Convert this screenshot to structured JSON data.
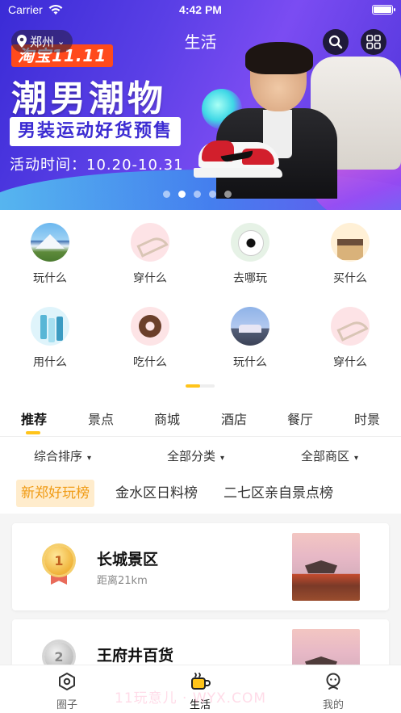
{
  "status_bar": {
    "carrier": "Carrier",
    "time": "4:42 PM"
  },
  "header": {
    "location": "郑州",
    "title": "生活"
  },
  "banner": {
    "badge": "淘宝11.11",
    "headline": "潮男潮物",
    "subheadline": "男装运动好货预售",
    "date_line": "活动时间：10.20-10.31",
    "slide_count": 5,
    "active_slide": 2
  },
  "categories": [
    {
      "label": "玩什么",
      "icon": "mountain-icon"
    },
    {
      "label": "穿什么",
      "icon": "high-heels-icon"
    },
    {
      "label": "去哪玩",
      "icon": "soccer-ball-icon"
    },
    {
      "label": "买什么",
      "icon": "house-icon"
    },
    {
      "label": "用什么",
      "icon": "cosmetics-icon"
    },
    {
      "label": "吃什么",
      "icon": "donut-icon"
    },
    {
      "label": "玩什么",
      "icon": "castle-icon"
    },
    {
      "label": "穿什么",
      "icon": "high-heels-icon"
    }
  ],
  "tabs": [
    "推荐",
    "景点",
    "商城",
    "酒店",
    "餐厅",
    "时景"
  ],
  "active_tab": "推荐",
  "filters": [
    "综合排序",
    "全部分类",
    "全部商区"
  ],
  "rank_tags": [
    "新郑好玩榜",
    "金水区日料榜",
    "二七区亲自景点榜"
  ],
  "list": [
    {
      "rank": "1",
      "name": "长城景区",
      "distance": "距离21km"
    },
    {
      "rank": "2",
      "name": "王府井百货",
      "distance": ""
    }
  ],
  "bottom_nav": [
    {
      "label": "圈子",
      "icon": "hexagon-icon"
    },
    {
      "label": "生活",
      "icon": "cup-icon"
    },
    {
      "label": "我的",
      "icon": "profile-icon"
    }
  ],
  "active_nav": "生活",
  "watermark": "11玩意儿 · WYX.COM",
  "colors": {
    "accent": "#ffc41a",
    "banner_primary": "#4c33d9",
    "promo_red": "#ff4a1c",
    "tag_orange": "#f09b14"
  }
}
